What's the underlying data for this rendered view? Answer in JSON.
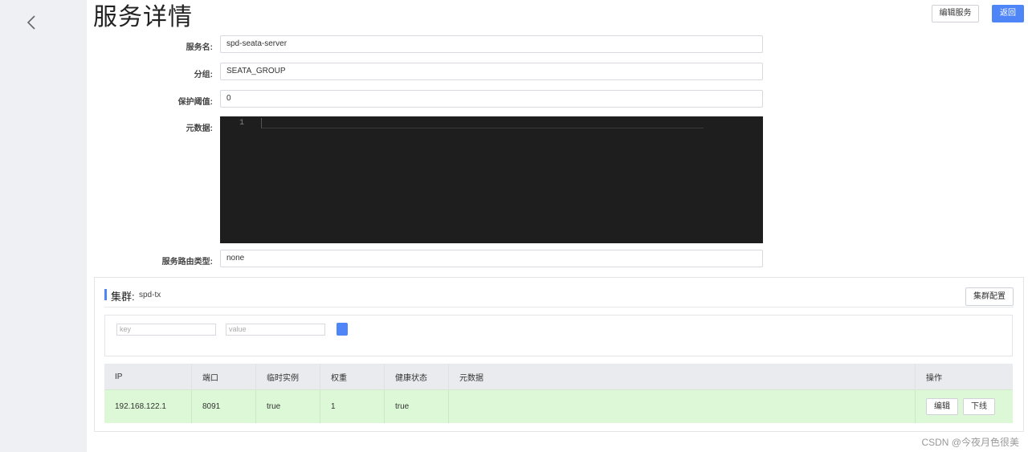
{
  "page": {
    "title": "服务详情"
  },
  "header_actions": {
    "edit_service": "编辑服务",
    "back": "返回"
  },
  "form": {
    "service_name": {
      "label": "服务名:",
      "value": "spd-seata-server"
    },
    "group": {
      "label": "分组:",
      "value": "SEATA_GROUP"
    },
    "protect_threshold": {
      "label": "保护阈值:",
      "value": "0"
    },
    "metadata": {
      "label": "元数据:",
      "line_number": "1"
    },
    "route_type": {
      "label": "服务路由类型:",
      "value": "none"
    }
  },
  "cluster": {
    "title": "集群:",
    "name": "spd-tx",
    "config_button": "集群配置",
    "filter": {
      "key_placeholder": "key",
      "value_placeholder": "value"
    },
    "columns": [
      "IP",
      "端口",
      "临时实例",
      "权重",
      "健康状态",
      "元数据",
      "操作"
    ],
    "rows": [
      {
        "ip": "192.168.122.1",
        "port": "8091",
        "ephemeral": "true",
        "weight": "1",
        "healthy": "true",
        "metadata": "",
        "actions": {
          "edit": "编辑",
          "offline": "下线"
        }
      }
    ]
  },
  "watermark": "CSDN @今夜月色很美",
  "colors": {
    "primary": "#4f86f7",
    "row_healthy_bg": "#dcf8d6",
    "editor_bg": "#1e1e1e",
    "sidebar_bg": "#eef0f4"
  }
}
